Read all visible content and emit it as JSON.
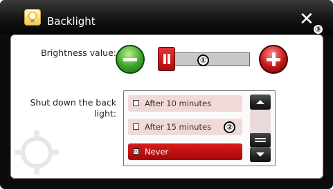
{
  "window": {
    "title": "Backlight",
    "app_icon": "lightbulb-icon",
    "close_icon": "close-icon"
  },
  "markers": {
    "one": "①",
    "two": "②",
    "three": "③"
  },
  "brightness": {
    "label": "Brightness value:",
    "decrease_icon": "minus-icon",
    "increase_icon": "plus-icon",
    "slider_value_fraction": 0.0
  },
  "shutdown": {
    "label": "Shut down the back light:",
    "options": [
      {
        "label": "After 10 minutes",
        "checked": false
      },
      {
        "label": "After 15 minutes",
        "checked": false
      },
      {
        "label": "Never",
        "checked": true
      }
    ],
    "checked_mark": "☑",
    "scroll_up_icon": "arrow-up-icon",
    "scroll_down_icon": "arrow-down-icon"
  },
  "colors": {
    "accent_red": "#c21616",
    "accent_green": "#3aa22a",
    "titlebar": "#141414",
    "option_bg": "#f2d9d9"
  }
}
